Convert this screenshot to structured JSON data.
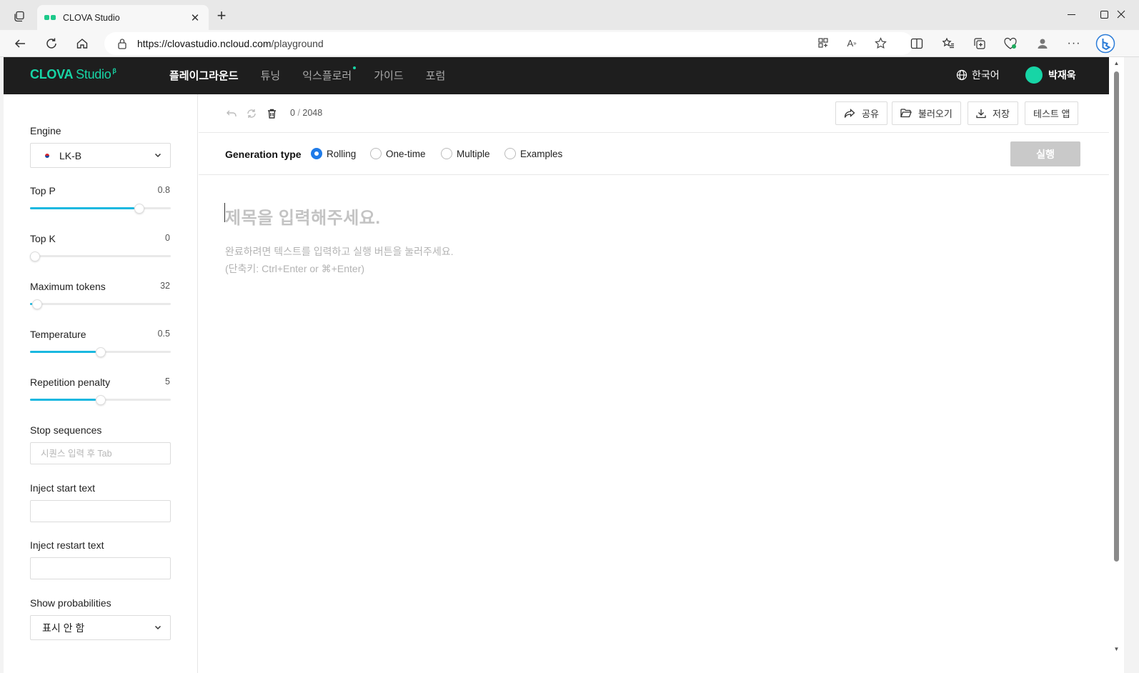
{
  "browser": {
    "tab_title": "CLOVA Studio",
    "url_host": "https://clovastudio.ncloud.com",
    "url_path": "/playground"
  },
  "header": {
    "logo_main": "CLOVA",
    "logo_sub": "Studio",
    "logo_beta": "β",
    "nav": [
      "플레이그라운드",
      "튜닝",
      "익스플로러",
      "가이드",
      "포럼"
    ],
    "language": "한국어",
    "user_name": "박재욱"
  },
  "sidebar": {
    "engine_label": "Engine",
    "engine_value": "LK-B",
    "top_p": {
      "label": "Top P",
      "value": "0.8",
      "fill": 0.8
    },
    "top_k": {
      "label": "Top K",
      "value": "0",
      "fill": 0.0
    },
    "max_tokens": {
      "label": "Maximum tokens",
      "value": "32",
      "fill": 0.016
    },
    "temperature": {
      "label": "Temperature",
      "value": "0.5",
      "fill": 0.5
    },
    "repetition_penalty": {
      "label": "Repetition penalty",
      "value": "5",
      "fill": 0.5
    },
    "stop_sequences_label": "Stop sequences",
    "stop_sequences_placeholder": "시퀀스 입력 후 Tab",
    "inject_start_label": "Inject start text",
    "inject_restart_label": "Inject restart text",
    "show_probabilities_label": "Show probabilities",
    "show_probabilities_value": "표시 안 함"
  },
  "toolbar": {
    "token_used": "0",
    "token_sep": "/",
    "token_max": "2048",
    "share": "공유",
    "load": "불러오기",
    "save": "저장",
    "test_app": "테스트 앱"
  },
  "generation": {
    "label": "Generation type",
    "options": [
      "Rolling",
      "One-time",
      "Multiple",
      "Examples"
    ],
    "selected": "Rolling",
    "run": "실행"
  },
  "editor": {
    "title_placeholder": "제목을 입력해주세요.",
    "body_placeholder_line1": "완료하려면 텍스트를 입력하고 실행 버튼을 눌러주세요.",
    "body_placeholder_line2": "(단축키: Ctrl+Enter or ⌘+Enter)"
  },
  "colors": {
    "brand": "#17d5a6",
    "header_bg": "#1e1e1e",
    "slider_fill": "#1ab8e0",
    "radio_checked": "#1f7be8",
    "run_disabled": "#c9c9c9"
  }
}
